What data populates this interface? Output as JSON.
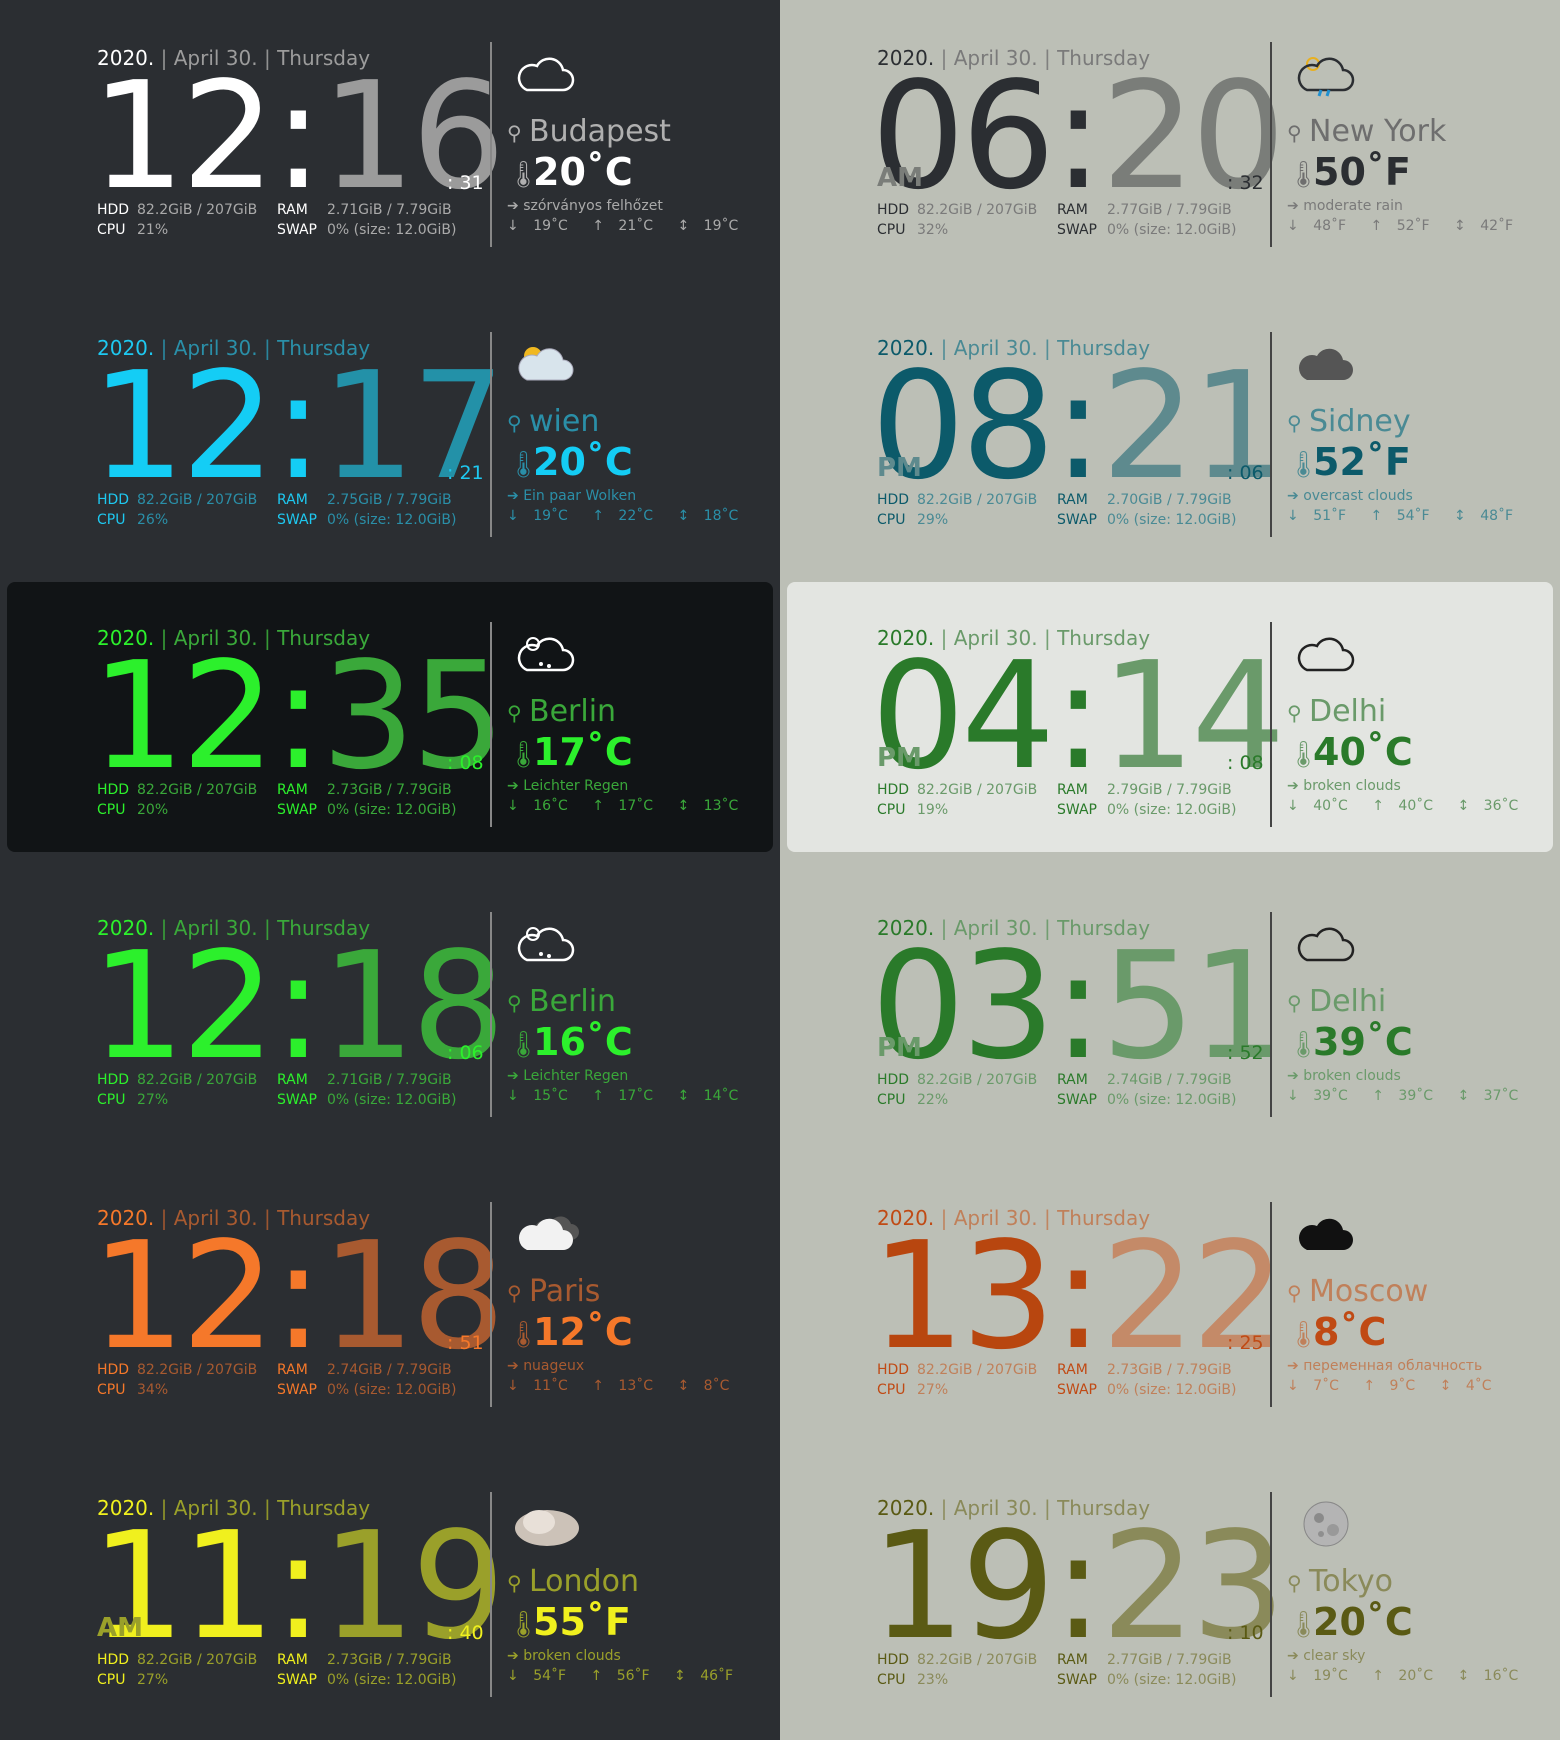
{
  "date": {
    "year": "2020.",
    "sep": "|",
    "day": "April 30.",
    "weekday": "Thursday"
  },
  "stats_labels": {
    "hdd": "HDD",
    "cpu": "CPU",
    "ram": "RAM",
    "swap": "SWAP"
  },
  "hdd_value": "82.2GiB / 207GiB",
  "swap_value": "0% (size: 12.0GiB)",
  "widgets": [
    {
      "hours": "12",
      "minutes": "16",
      "seconds": ": 31",
      "ampm": "",
      "ram": "2.71GiB / 7.79GiB",
      "cpu": "21%",
      "city": "Budapest",
      "temp": "20˚C",
      "desc": "szórványos felhőzet",
      "min": "19˚C",
      "max": "21˚C",
      "feels": "19˚C",
      "icon": "cloud-outline-icon",
      "colors": {
        "date": "#ffffff",
        "date2": "#9c9c9c",
        "h": "#ffffff",
        "m": "#9b9b9b",
        "lbl": "#ffffff",
        "val": "#aaaaaa",
        "city": "#b0b0b0",
        "temp": "#ffffff",
        "desc": "#aaaaaa",
        "div": "#888888",
        "bg": ""
      }
    },
    {
      "hours": "06",
      "minutes": "20",
      "seconds": ": 32",
      "ampm": "AM",
      "ram": "2.77GiB / 7.79GiB",
      "cpu": "32%",
      "city": "New York",
      "temp": "50˚F",
      "desc": "moderate rain",
      "min": "48˚F",
      "max": "52˚F",
      "feels": "42˚F",
      "icon": "sun-rain-icon",
      "colors": {
        "date": "#2b2e32",
        "date2": "#7a7a7a",
        "h": "#2b2e32",
        "m": "#7a7d79",
        "lbl": "#2b2e32",
        "val": "#7a7a7a",
        "city": "#6e6e6e",
        "temp": "#2b2e32",
        "desc": "#7a7a7a",
        "div": "#444444",
        "bg": ""
      }
    },
    {
      "hours": "12",
      "minutes": "17",
      "seconds": ": 21",
      "ampm": "",
      "ram": "2.75GiB / 7.79GiB",
      "cpu": "26%",
      "city": "wien",
      "temp": "20˚C",
      "desc": "Ein paar Wolken",
      "min": "19˚C",
      "max": "22˚C",
      "feels": "18˚C",
      "icon": "sun-cloud-icon",
      "colors": {
        "date": "#1ec8f0",
        "date2": "#2a8fa8",
        "h": "#14cdf5",
        "m": "#2391a8",
        "lbl": "#1ec8f0",
        "val": "#2a8fa8",
        "city": "#2a8fa8",
        "temp": "#14cdf5",
        "desc": "#2a8fa8",
        "div": "#888888",
        "bg": ""
      }
    },
    {
      "hours": "08",
      "minutes": "21",
      "seconds": ": 06",
      "ampm": "PM",
      "ram": "2.70GiB / 7.79GiB",
      "cpu": "29%",
      "city": "Sidney",
      "temp": "52˚F",
      "desc": "overcast clouds",
      "min": "51˚F",
      "max": "54˚F",
      "feels": "48˚F",
      "icon": "overcast-icon",
      "colors": {
        "date": "#0c5a6a",
        "date2": "#4a8a94",
        "h": "#0c5a6a",
        "m": "#5e8a8e",
        "lbl": "#0c5a6a",
        "val": "#4a8a94",
        "city": "#4a8a94",
        "temp": "#0c5a6a",
        "desc": "#4a8a94",
        "div": "#444444",
        "bg": ""
      }
    },
    {
      "hours": "12",
      "minutes": "35",
      "seconds": ": 08",
      "ampm": "",
      "ram": "2.73GiB / 7.79GiB",
      "cpu": "20%",
      "city": "Berlin",
      "temp": "17˚C",
      "desc": "Leichter Regen",
      "min": "16˚C",
      "max": "17˚C",
      "feels": "13˚C",
      "icon": "sun-rain-outline-icon",
      "colors": {
        "date": "#2cf02c",
        "date2": "#3aa83a",
        "h": "#2cf02c",
        "m": "#3aa83a",
        "lbl": "#2cf02c",
        "val": "#3aa83a",
        "city": "#3aa83a",
        "temp": "#2cf02c",
        "desc": "#3aa83a",
        "div": "#888888",
        "bg": "#111416"
      }
    },
    {
      "hours": "04",
      "minutes": "14",
      "seconds": ": 08",
      "ampm": "PM",
      "ram": "2.79GiB / 7.79GiB",
      "cpu": "19%",
      "city": "Delhi",
      "temp": "40˚C",
      "desc": "broken clouds",
      "min": "40˚C",
      "max": "40˚C",
      "feels": "36˚C",
      "icon": "cloud-dark-outline-icon",
      "colors": {
        "date": "#2a7a2a",
        "date2": "#6a9a6a",
        "h": "#2a7a2a",
        "m": "#6a9a6a",
        "lbl": "#2a7a2a",
        "val": "#6a9a6a",
        "city": "#6a9a6a",
        "temp": "#2a7a2a",
        "desc": "#6a9a6a",
        "div": "#444444",
        "bg": "#e3e5e1"
      }
    },
    {
      "hours": "12",
      "minutes": "18",
      "seconds": ": 06",
      "ampm": "",
      "ram": "2.71GiB / 7.79GiB",
      "cpu": "27%",
      "city": "Berlin",
      "temp": "16˚C",
      "desc": "Leichter Regen",
      "min": "15˚C",
      "max": "17˚C",
      "feels": "14˚C",
      "icon": "sun-rain-outline-icon",
      "colors": {
        "date": "#2cf02c",
        "date2": "#3aa83a",
        "h": "#2cf02c",
        "m": "#3aa83a",
        "lbl": "#2cf02c",
        "val": "#3aa83a",
        "city": "#3aa83a",
        "temp": "#2cf02c",
        "desc": "#3aa83a",
        "div": "#888888",
        "bg": ""
      }
    },
    {
      "hours": "03",
      "minutes": "51",
      "seconds": ": 52",
      "ampm": "PM",
      "ram": "2.74GiB / 7.79GiB",
      "cpu": "22%",
      "city": "Delhi",
      "temp": "39˚C",
      "desc": "broken clouds",
      "min": "39˚C",
      "max": "39˚C",
      "feels": "37˚C",
      "icon": "cloud-dark-outline-icon",
      "colors": {
        "date": "#2a7a2a",
        "date2": "#6a9a6a",
        "h": "#2a7a2a",
        "m": "#6a9a6a",
        "lbl": "#2a7a2a",
        "val": "#6a9a6a",
        "city": "#6a9a6a",
        "temp": "#2a7a2a",
        "desc": "#6a9a6a",
        "div": "#444444",
        "bg": ""
      }
    },
    {
      "hours": "12",
      "minutes": "18",
      "seconds": ": 51",
      "ampm": "",
      "ram": "2.74GiB / 7.79GiB",
      "cpu": "34%",
      "city": "Paris",
      "temp": "12˚C",
      "desc": "nuageux",
      "min": "11˚C",
      "max": "13˚C",
      "feels": "8˚C",
      "icon": "clouds-white-icon",
      "colors": {
        "date": "#f5782a",
        "date2": "#a85a30",
        "h": "#f5782a",
        "m": "#a85a30",
        "lbl": "#f5782a",
        "val": "#a85a30",
        "city": "#a85a30",
        "temp": "#f5782a",
        "desc": "#a85a30",
        "div": "#888888",
        "bg": ""
      }
    },
    {
      "hours": "13",
      "minutes": "22",
      "seconds": ": 25",
      "ampm": "",
      "ram": "2.73GiB / 7.79GiB",
      "cpu": "27%",
      "city": "Moscow",
      "temp": "8˚C",
      "desc": "переменная облачность",
      "min": "7˚C",
      "max": "9˚C",
      "feels": "4˚C",
      "icon": "cloud-black-icon",
      "colors": {
        "date": "#c04a14",
        "date2": "#c0805a",
        "h": "#b8460f",
        "m": "#c48a68",
        "lbl": "#c04a14",
        "val": "#c0805a",
        "city": "#c0805a",
        "temp": "#c04a14",
        "desc": "#c0805a",
        "div": "#444444",
        "bg": ""
      }
    },
    {
      "hours": "11",
      "minutes": "19",
      "seconds": ": 40",
      "ampm": "AM",
      "ram": "2.73GiB / 7.79GiB",
      "cpu": "27%",
      "city": "London",
      "temp": "55˚F",
      "desc": "broken clouds",
      "min": "54˚F",
      "max": "56˚F",
      "feels": "46˚F",
      "icon": "cloud-photo-icon",
      "colors": {
        "date": "#f0f01e",
        "date2": "#9aa02a",
        "h": "#f0f01e",
        "m": "#9aa02a",
        "lbl": "#f0f01e",
        "val": "#9aa02a",
        "city": "#9aa02a",
        "temp": "#f0f01e",
        "desc": "#9aa02a",
        "div": "#888888",
        "bg": ""
      }
    },
    {
      "hours": "19",
      "minutes": "23",
      "seconds": ": 10",
      "ampm": "",
      "ram": "2.77GiB / 7.79GiB",
      "cpu": "23%",
      "city": "Tokyo",
      "temp": "20˚C",
      "desc": "clear sky",
      "min": "19˚C",
      "max": "20˚C",
      "feels": "16˚C",
      "icon": "moon-icon",
      "colors": {
        "date": "#5a5a14",
        "date2": "#8a8a5a",
        "h": "#5a5a14",
        "m": "#8a8a5a",
        "lbl": "#5a5a14",
        "val": "#8a8a5a",
        "city": "#8a8a5a",
        "temp": "#5a5a14",
        "desc": "#8a8a5a",
        "div": "#444444",
        "bg": ""
      }
    }
  ]
}
